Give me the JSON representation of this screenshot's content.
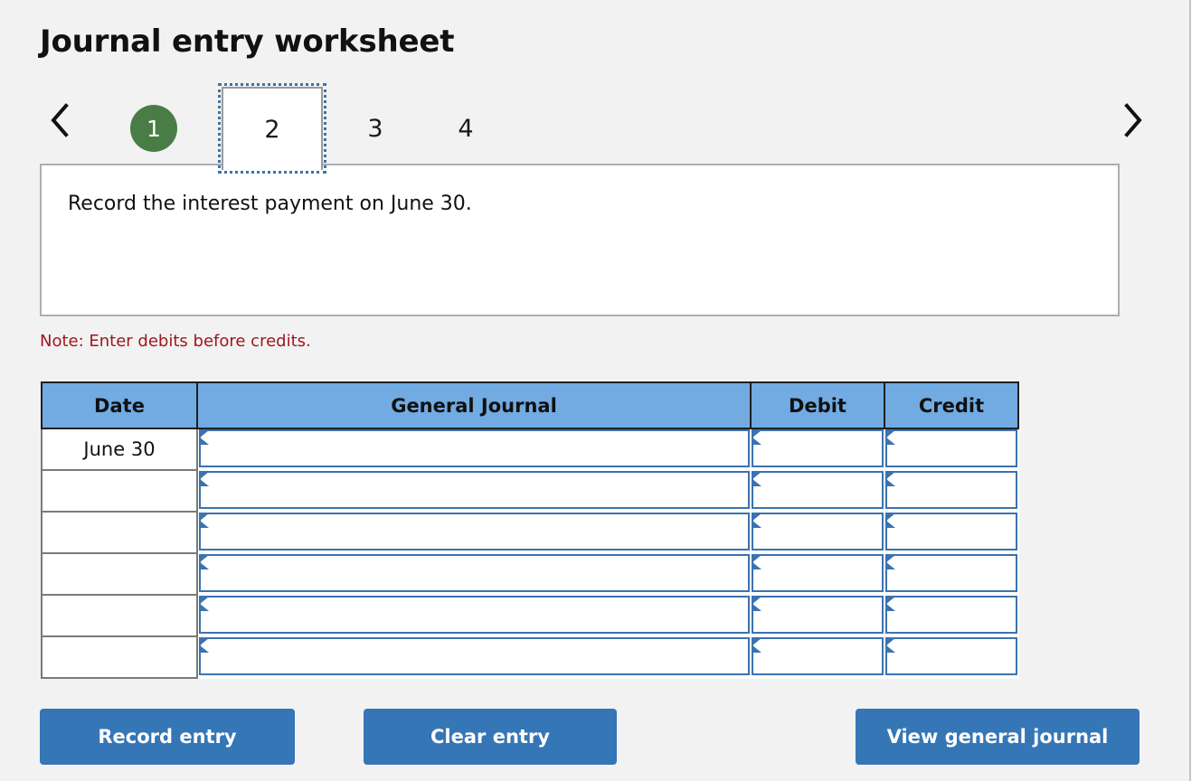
{
  "page": {
    "title": "Journal entry worksheet"
  },
  "pager": {
    "prev_label": "‹",
    "next_label": "›",
    "steps": [
      {
        "label": "1",
        "state": "completed"
      },
      {
        "label": "2",
        "state": "current"
      },
      {
        "label": "3",
        "state": "upcoming"
      },
      {
        "label": "4",
        "state": "upcoming"
      }
    ]
  },
  "instruction": {
    "text": "Record the interest payment on June 30."
  },
  "note": {
    "text": "Note: Enter debits before credits."
  },
  "journal": {
    "headers": {
      "date": "Date",
      "general_journal": "General Journal",
      "debit": "Debit",
      "credit": "Credit"
    },
    "rows": [
      {
        "date": "June 30",
        "account": "",
        "debit": "",
        "credit": ""
      },
      {
        "date": "",
        "account": "",
        "debit": "",
        "credit": ""
      },
      {
        "date": "",
        "account": "",
        "debit": "",
        "credit": ""
      },
      {
        "date": "",
        "account": "",
        "debit": "",
        "credit": ""
      },
      {
        "date": "",
        "account": "",
        "debit": "",
        "credit": ""
      },
      {
        "date": "",
        "account": "",
        "debit": "",
        "credit": ""
      }
    ]
  },
  "actions": {
    "record_label": "Record entry",
    "clear_label": "Clear entry",
    "view_label": "View general journal"
  },
  "colors": {
    "page_background": "#f2f2f2",
    "step_completed": "#4a7d46",
    "step_focus_ring": "#3b72b0",
    "table_header": "#71abe2",
    "field_border": "#3b72b0",
    "note_text": "#a2161c",
    "button": "#3576b6"
  }
}
